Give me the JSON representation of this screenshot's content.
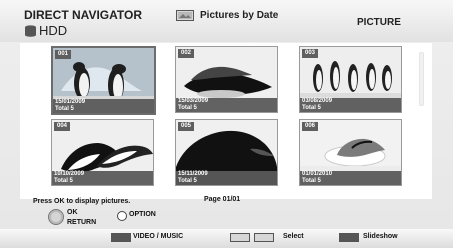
{
  "header": {
    "title": "DIRECT NAVIGATOR",
    "drive": "HDD",
    "view_label": "Pictures by Date",
    "mode": "PICTURE"
  },
  "thumbnails": [
    {
      "num": "001",
      "date": "15/01/2009",
      "total": "Total 5"
    },
    {
      "num": "002",
      "date": "15/03/2009",
      "total": "Total 5"
    },
    {
      "num": "003",
      "date": "03/08/2009",
      "total": "Total 5"
    },
    {
      "num": "004",
      "date": "10/10/2009",
      "total": "Total 5"
    },
    {
      "num": "005",
      "date": "15/11/2009",
      "total": "Total 5"
    },
    {
      "num": "006",
      "date": "01/01/2010",
      "total": "Total 5"
    }
  ],
  "help": {
    "instruction": "Press OK to display pictures.",
    "page": "Page 01/01",
    "ok": "OK",
    "return": "RETURN",
    "option": "OPTION"
  },
  "footer": {
    "video_music": "VIDEO / MUSIC",
    "select": "Select",
    "slideshow": "Slideshow"
  }
}
